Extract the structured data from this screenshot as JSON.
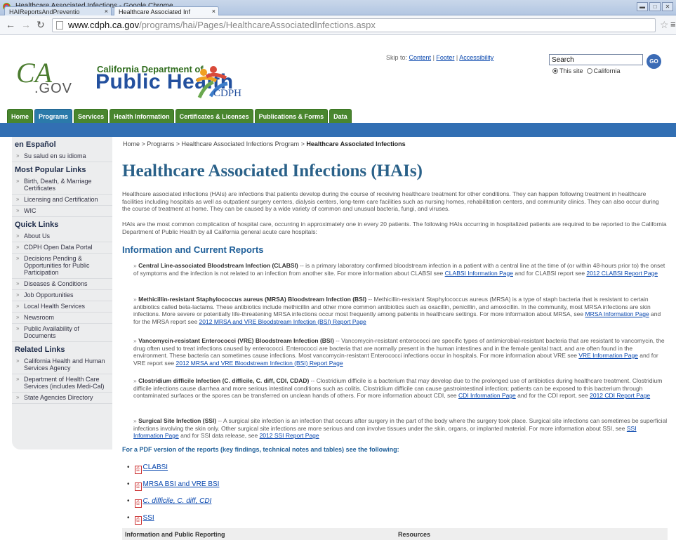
{
  "browser": {
    "window_title": "Healthcare Associated Infections - Google Chrome",
    "tabs": [
      {
        "label": "HAIReportsAndPreventio"
      },
      {
        "label": "Healthcare Associated Inf"
      }
    ],
    "url_domain": "www.cdph.ca.gov",
    "url_path": "/programs/hai/Pages/HealthcareAssociatedInfections.aspx"
  },
  "header": {
    "cagov_logo": "CA",
    "cagov_sub": ".GOV",
    "dept_top": "California Department of",
    "dept_main": "Public Health",
    "logo_text": "CDPH",
    "skip_label": "Skip to:",
    "skip_links": [
      "Content",
      "Footer",
      "Accessibility"
    ],
    "search_value": "Search",
    "search_button": "GO",
    "radio_site": "This site",
    "radio_california": "California"
  },
  "nav": {
    "tabs": [
      "Home",
      "Programs",
      "Services",
      "Health Information",
      "Certificates & Licenses",
      "Publications & Forms",
      "Data"
    ]
  },
  "sidebar": {
    "espanol_heading": "en Español",
    "espanol_items": [
      "Su salud en su idioma"
    ],
    "popular_heading": "Most Popular Links",
    "popular_items": [
      "Birth, Death, & Marriage Certificates",
      "Licensing and Certification",
      "WIC"
    ],
    "quick_heading": "Quick Links",
    "quick_items": [
      "About Us",
      "CDPH Open Data Portal",
      "Decisions Pending & Opportunities for Public Participation",
      "Diseases & Conditions",
      "Job Opportunities",
      "Local Health Services",
      "Newsroom",
      "Public Availability of Documents"
    ],
    "related_heading": "Related Links",
    "related_items": [
      "California Health and Human Services Agency",
      "Department of Health Care Services (includes Medi-Cal)",
      "State Agencies Directory"
    ]
  },
  "main": {
    "breadcrumb": "Home > Programs > Healthcare Associated Infections Program > ",
    "breadcrumb_current": "Healthcare Associated Infections",
    "title": "Healthcare Associated Infections (HAIs)",
    "intro1": "Healthcare associated infections (HAIs) are infections that patients develop during the course of receiving healthcare treatment for other conditions. They can happen following treatment in healthcare facilities including hospitals as well as outpatient surgery centers, dialysis centers, long-term care facilities such as nursing homes, rehabilitation centers, and community clinics. They can also occur during the course of treatment at home. They can be caused by a wide variety of common and unusual bacteria, fungi, and viruses.",
    "intro2": "HAIs are the most common complication of hospital care, occurring in approximately one in every 20 patients. The following HAIs occurring in hospitalized patients are required to be reported to the California Department of Public Health by all California general acute care hospitals:",
    "section_heading": "Information and Current Reports",
    "items": [
      {
        "title": "Central Line-associated Bloodstream Infection (CLABSI)",
        "body": " -- is a primary laboratory confirmed bloodstream infection in a patient with a central line at the time of (or within 48-hours prior to) the onset of symptoms and the infection is not related to an infection from another site. For more information about CLABSI see ",
        "link1": "CLABSI Information Page",
        "mid": " and for CLABSI report see ",
        "link2": "2012 CLABSI Report Page"
      },
      {
        "title": "Methicillin-resistant Staphylococcus aureus (MRSA) Bloodstream Infection (BSI)",
        "body": " -- Methicillin-resistant Staphylococcus aureus (MRSA) is a type of staph bacteria that is resistant to certain antibiotics called beta-lactams. These antibiotics include methicillin and other more common antibiotics such as oxacillin, penicillin, and amoxicillin. In the community, most MRSA infections are skin infections. More severe or potentially life-threatening MRSA infections occur most frequently among patients in healthcare settings. For more information about MRSA, see ",
        "link1": "MRSA Information Page",
        "mid": " and for the MRSA report see ",
        "link2": "2012 MRSA and VRE Bloodstream Infection (BSI) Report Page"
      },
      {
        "title": "Vancomycin-resistant Enterococci (VRE) Bloodstream Infection (BSI)",
        "body": " -- Vancomycin-resistant enterococci are specific types of antimicrobial-resistant bacteria that are resistant to vancomycin, the drug often used to treat infections caused by enterococci. Enterococci are bacteria that are normally present in the human intestines and in the female genital tract, and are often found in the environment. These bacteria can sometimes cause infections. Most vancomycin-resistant Enterococci infections occur in hospitals. For more information about VRE see ",
        "link1": "VRE Information Page",
        "mid": " and for VRE report see ",
        "link2": "2012 MRSA and VRE Bloodstream Infection (BSI) Report Page"
      },
      {
        "title": "Clostridium difficile Infection (C. difficile, C. diff, CDI, CDAD)",
        "body": " -- Clostridium difficile is a bacterium that may develop due to the prolonged use of antibiotics during healthcare treatment. Clostridium difficile infections cause diarrhea and more serious intestinal conditions such as colitis. Clostridium difficile can cause gastrointestinal infection; patients can be exposed to this bacterium through contaminated surfaces or the spores can be transferred on unclean hands of others. For more information abouct CDI, see ",
        "link1": "CDI Information Page",
        "mid": " and for the CDI report, see ",
        "link2": "2012 CDI Report Page"
      },
      {
        "title": "Surgical Site Infection (SSI)",
        "body": " -- A surgical site infection is an infection that occurs after surgery in the part of the body where the surgery took place. Surgical site infections can sometimes be superficial infections involving the skin only. Other surgical site infections are more serious and can involve tissues under the skin, organs, or implanted material.  For more information about SSI, see ",
        "link1": "SSI Information Page",
        "mid": " and for SSI data release, see ",
        "link2": "2012 SSI Report Page"
      }
    ],
    "pdf_intro": "For a PDF version of the reports (key findings, technical notes and tables) see the following:",
    "pdf_links": [
      "CLABSI",
      "MRSA BSI and VRE BSI",
      "C. difficile, C. diff, CDI",
      "SSI"
    ],
    "table_head_left": "Information and Public Reporting",
    "table_head_right": "Resources"
  },
  "colors": {
    "nav_green": "#49862e",
    "nav_active": "#2b7aaa",
    "blue_bar": "#326fb3",
    "title_blue": "#2a6189"
  }
}
